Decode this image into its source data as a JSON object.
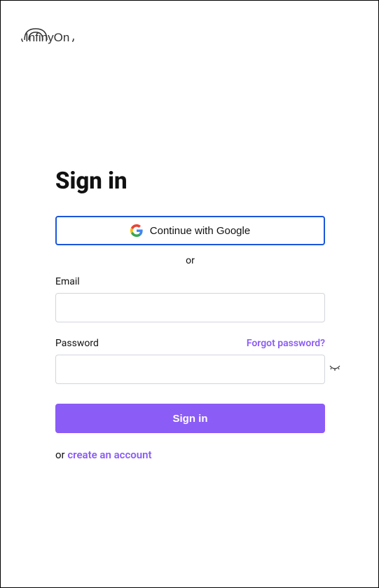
{
  "brand": {
    "name": "InfinyOn"
  },
  "auth": {
    "title": "Sign in",
    "google_button_label": "Continue with Google",
    "divider_text": "or",
    "email_label": "Email",
    "email_value": "",
    "password_label": "Password",
    "password_value": "",
    "forgot_password_label": "Forgot password?",
    "signin_button_label": "Sign in",
    "signup_prefix": "or ",
    "signup_link_label": "create an account"
  },
  "colors": {
    "accent": "#8b5cf6",
    "google_border": "#1a56db"
  }
}
